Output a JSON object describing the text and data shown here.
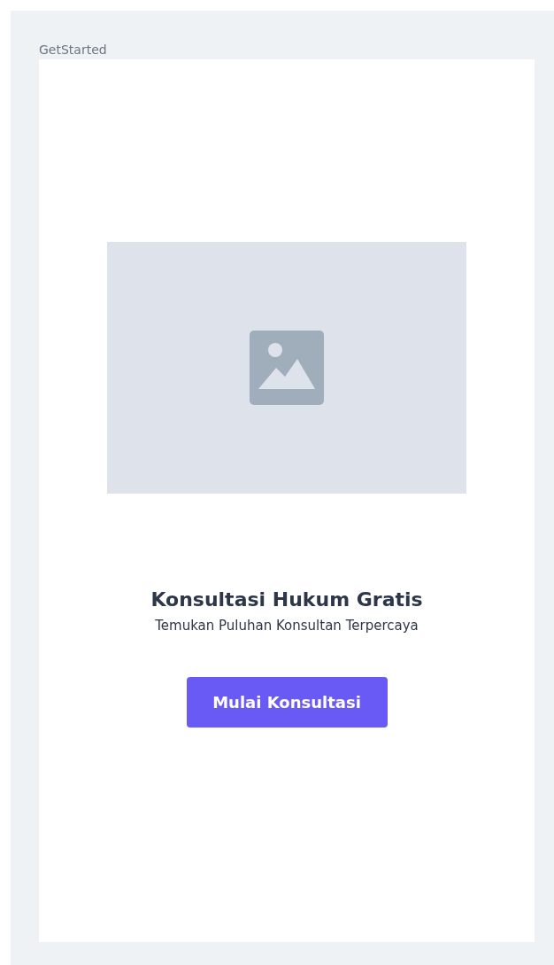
{
  "frame_label": "GetStarted",
  "title": "Konsultasi Hukum Gratis",
  "subtitle": "Temukan Puluhan Konsultan Terpercaya",
  "button": "Mulai Konsultasi"
}
